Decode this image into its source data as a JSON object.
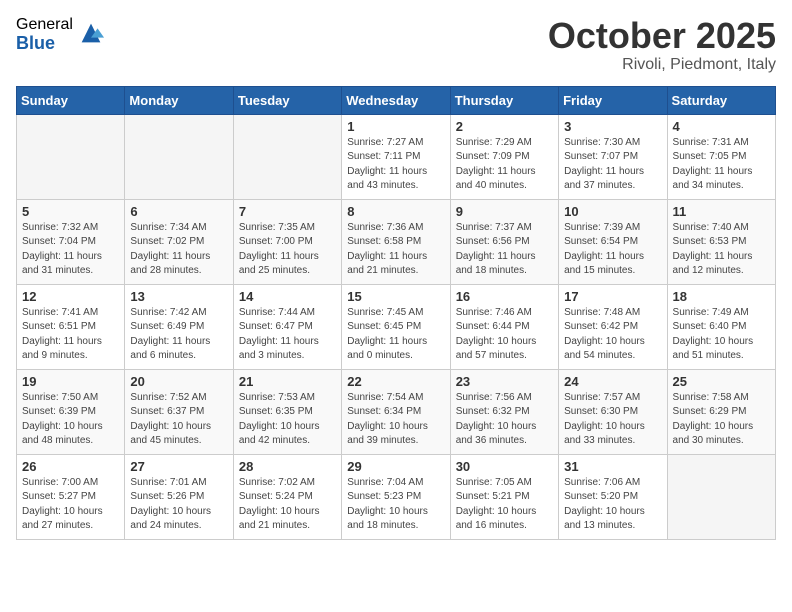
{
  "logo": {
    "general": "General",
    "blue": "Blue"
  },
  "header": {
    "month": "October 2025",
    "location": "Rivoli, Piedmont, Italy"
  },
  "weekdays": [
    "Sunday",
    "Monday",
    "Tuesday",
    "Wednesday",
    "Thursday",
    "Friday",
    "Saturday"
  ],
  "weeks": [
    [
      {
        "day": "",
        "sunrise": "",
        "sunset": "",
        "daylight": ""
      },
      {
        "day": "",
        "sunrise": "",
        "sunset": "",
        "daylight": ""
      },
      {
        "day": "",
        "sunrise": "",
        "sunset": "",
        "daylight": ""
      },
      {
        "day": "1",
        "sunrise": "Sunrise: 7:27 AM",
        "sunset": "Sunset: 7:11 PM",
        "daylight": "Daylight: 11 hours and 43 minutes."
      },
      {
        "day": "2",
        "sunrise": "Sunrise: 7:29 AM",
        "sunset": "Sunset: 7:09 PM",
        "daylight": "Daylight: 11 hours and 40 minutes."
      },
      {
        "day": "3",
        "sunrise": "Sunrise: 7:30 AM",
        "sunset": "Sunset: 7:07 PM",
        "daylight": "Daylight: 11 hours and 37 minutes."
      },
      {
        "day": "4",
        "sunrise": "Sunrise: 7:31 AM",
        "sunset": "Sunset: 7:05 PM",
        "daylight": "Daylight: 11 hours and 34 minutes."
      }
    ],
    [
      {
        "day": "5",
        "sunrise": "Sunrise: 7:32 AM",
        "sunset": "Sunset: 7:04 PM",
        "daylight": "Daylight: 11 hours and 31 minutes."
      },
      {
        "day": "6",
        "sunrise": "Sunrise: 7:34 AM",
        "sunset": "Sunset: 7:02 PM",
        "daylight": "Daylight: 11 hours and 28 minutes."
      },
      {
        "day": "7",
        "sunrise": "Sunrise: 7:35 AM",
        "sunset": "Sunset: 7:00 PM",
        "daylight": "Daylight: 11 hours and 25 minutes."
      },
      {
        "day": "8",
        "sunrise": "Sunrise: 7:36 AM",
        "sunset": "Sunset: 6:58 PM",
        "daylight": "Daylight: 11 hours and 21 minutes."
      },
      {
        "day": "9",
        "sunrise": "Sunrise: 7:37 AM",
        "sunset": "Sunset: 6:56 PM",
        "daylight": "Daylight: 11 hours and 18 minutes."
      },
      {
        "day": "10",
        "sunrise": "Sunrise: 7:39 AM",
        "sunset": "Sunset: 6:54 PM",
        "daylight": "Daylight: 11 hours and 15 minutes."
      },
      {
        "day": "11",
        "sunrise": "Sunrise: 7:40 AM",
        "sunset": "Sunset: 6:53 PM",
        "daylight": "Daylight: 11 hours and 12 minutes."
      }
    ],
    [
      {
        "day": "12",
        "sunrise": "Sunrise: 7:41 AM",
        "sunset": "Sunset: 6:51 PM",
        "daylight": "Daylight: 11 hours and 9 minutes."
      },
      {
        "day": "13",
        "sunrise": "Sunrise: 7:42 AM",
        "sunset": "Sunset: 6:49 PM",
        "daylight": "Daylight: 11 hours and 6 minutes."
      },
      {
        "day": "14",
        "sunrise": "Sunrise: 7:44 AM",
        "sunset": "Sunset: 6:47 PM",
        "daylight": "Daylight: 11 hours and 3 minutes."
      },
      {
        "day": "15",
        "sunrise": "Sunrise: 7:45 AM",
        "sunset": "Sunset: 6:45 PM",
        "daylight": "Daylight: 11 hours and 0 minutes."
      },
      {
        "day": "16",
        "sunrise": "Sunrise: 7:46 AM",
        "sunset": "Sunset: 6:44 PM",
        "daylight": "Daylight: 10 hours and 57 minutes."
      },
      {
        "day": "17",
        "sunrise": "Sunrise: 7:48 AM",
        "sunset": "Sunset: 6:42 PM",
        "daylight": "Daylight: 10 hours and 54 minutes."
      },
      {
        "day": "18",
        "sunrise": "Sunrise: 7:49 AM",
        "sunset": "Sunset: 6:40 PM",
        "daylight": "Daylight: 10 hours and 51 minutes."
      }
    ],
    [
      {
        "day": "19",
        "sunrise": "Sunrise: 7:50 AM",
        "sunset": "Sunset: 6:39 PM",
        "daylight": "Daylight: 10 hours and 48 minutes."
      },
      {
        "day": "20",
        "sunrise": "Sunrise: 7:52 AM",
        "sunset": "Sunset: 6:37 PM",
        "daylight": "Daylight: 10 hours and 45 minutes."
      },
      {
        "day": "21",
        "sunrise": "Sunrise: 7:53 AM",
        "sunset": "Sunset: 6:35 PM",
        "daylight": "Daylight: 10 hours and 42 minutes."
      },
      {
        "day": "22",
        "sunrise": "Sunrise: 7:54 AM",
        "sunset": "Sunset: 6:34 PM",
        "daylight": "Daylight: 10 hours and 39 minutes."
      },
      {
        "day": "23",
        "sunrise": "Sunrise: 7:56 AM",
        "sunset": "Sunset: 6:32 PM",
        "daylight": "Daylight: 10 hours and 36 minutes."
      },
      {
        "day": "24",
        "sunrise": "Sunrise: 7:57 AM",
        "sunset": "Sunset: 6:30 PM",
        "daylight": "Daylight: 10 hours and 33 minutes."
      },
      {
        "day": "25",
        "sunrise": "Sunrise: 7:58 AM",
        "sunset": "Sunset: 6:29 PM",
        "daylight": "Daylight: 10 hours and 30 minutes."
      }
    ],
    [
      {
        "day": "26",
        "sunrise": "Sunrise: 7:00 AM",
        "sunset": "Sunset: 5:27 PM",
        "daylight": "Daylight: 10 hours and 27 minutes."
      },
      {
        "day": "27",
        "sunrise": "Sunrise: 7:01 AM",
        "sunset": "Sunset: 5:26 PM",
        "daylight": "Daylight: 10 hours and 24 minutes."
      },
      {
        "day": "28",
        "sunrise": "Sunrise: 7:02 AM",
        "sunset": "Sunset: 5:24 PM",
        "daylight": "Daylight: 10 hours and 21 minutes."
      },
      {
        "day": "29",
        "sunrise": "Sunrise: 7:04 AM",
        "sunset": "Sunset: 5:23 PM",
        "daylight": "Daylight: 10 hours and 18 minutes."
      },
      {
        "day": "30",
        "sunrise": "Sunrise: 7:05 AM",
        "sunset": "Sunset: 5:21 PM",
        "daylight": "Daylight: 10 hours and 16 minutes."
      },
      {
        "day": "31",
        "sunrise": "Sunrise: 7:06 AM",
        "sunset": "Sunset: 5:20 PM",
        "daylight": "Daylight: 10 hours and 13 minutes."
      },
      {
        "day": "",
        "sunrise": "",
        "sunset": "",
        "daylight": ""
      }
    ]
  ]
}
